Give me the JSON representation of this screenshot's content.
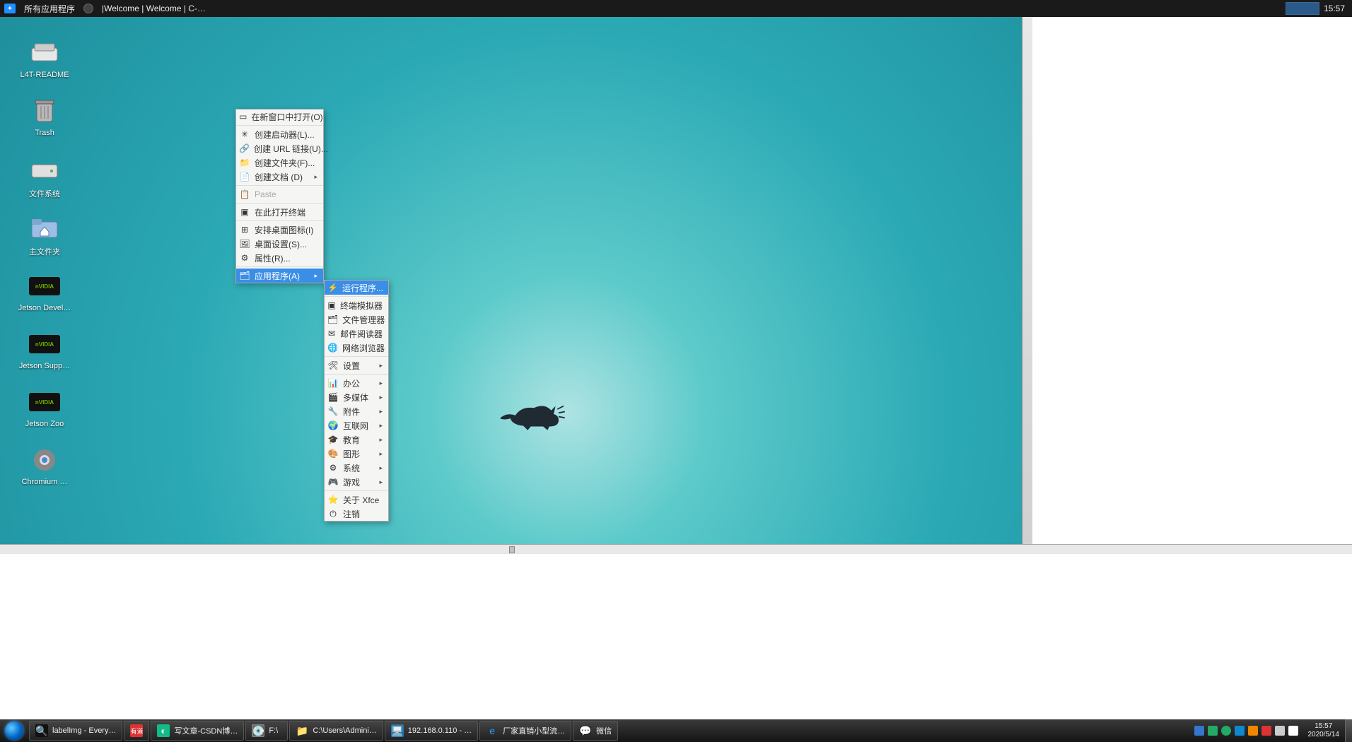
{
  "vnc_bar": {
    "app_button": "所有应用程序",
    "window_title": "|Welcome | Welcome | C-…",
    "clock": "15:57"
  },
  "desktop_icons": {
    "readme": "L4T-README",
    "trash": "Trash",
    "filesystem": "文件系统",
    "home": "主文件夹",
    "jetson_dev": "Jetson Devel…",
    "jetson_supp": "Jetson Supp…",
    "jetson_zoo": "Jetson Zoo",
    "chromium": "Chromium …"
  },
  "context_menu": {
    "open_new_window": "在新窗口中打开(O)",
    "create_launcher": "创建启动器(L)...",
    "create_url": "创建 URL 链接(U)...",
    "create_folder": "创建文件夹(F)...",
    "create_document": "创建文档 (D)",
    "paste": "Paste",
    "open_terminal": "在此打开终端",
    "arrange_icons": "安排桌面图标(I)",
    "desktop_settings": "桌面设置(S)...",
    "properties": "属性(R)...",
    "applications": "应用程序(A)"
  },
  "apps_submenu": {
    "run_program": "运行程序...",
    "terminal_emulator": "终端模拟器",
    "file_manager": "文件管理器",
    "mail_reader": "邮件阅读器",
    "web_browser": "网络浏览器",
    "settings": "设置",
    "office": "办公",
    "multimedia": "多媒体",
    "accessories": "附件",
    "internet": "互联网",
    "education": "教育",
    "graphics": "图形",
    "system": "系统",
    "games": "游戏",
    "about_xfce": "关于 Xfce",
    "logout": "注销"
  },
  "taskbar": {
    "buttons": {
      "labelimg": "labelImg - Every…",
      "youdao": "有道",
      "csdn": "写文章-CSDN博…",
      "f_drive": "F:\\",
      "users": "C:\\Users\\Admini…",
      "vnc": "192.168.0.110 - …",
      "ie": "厂家直销小型流…",
      "wechat": "微信"
    },
    "clock_time": "15:57",
    "clock_date": "2020/5/14"
  }
}
